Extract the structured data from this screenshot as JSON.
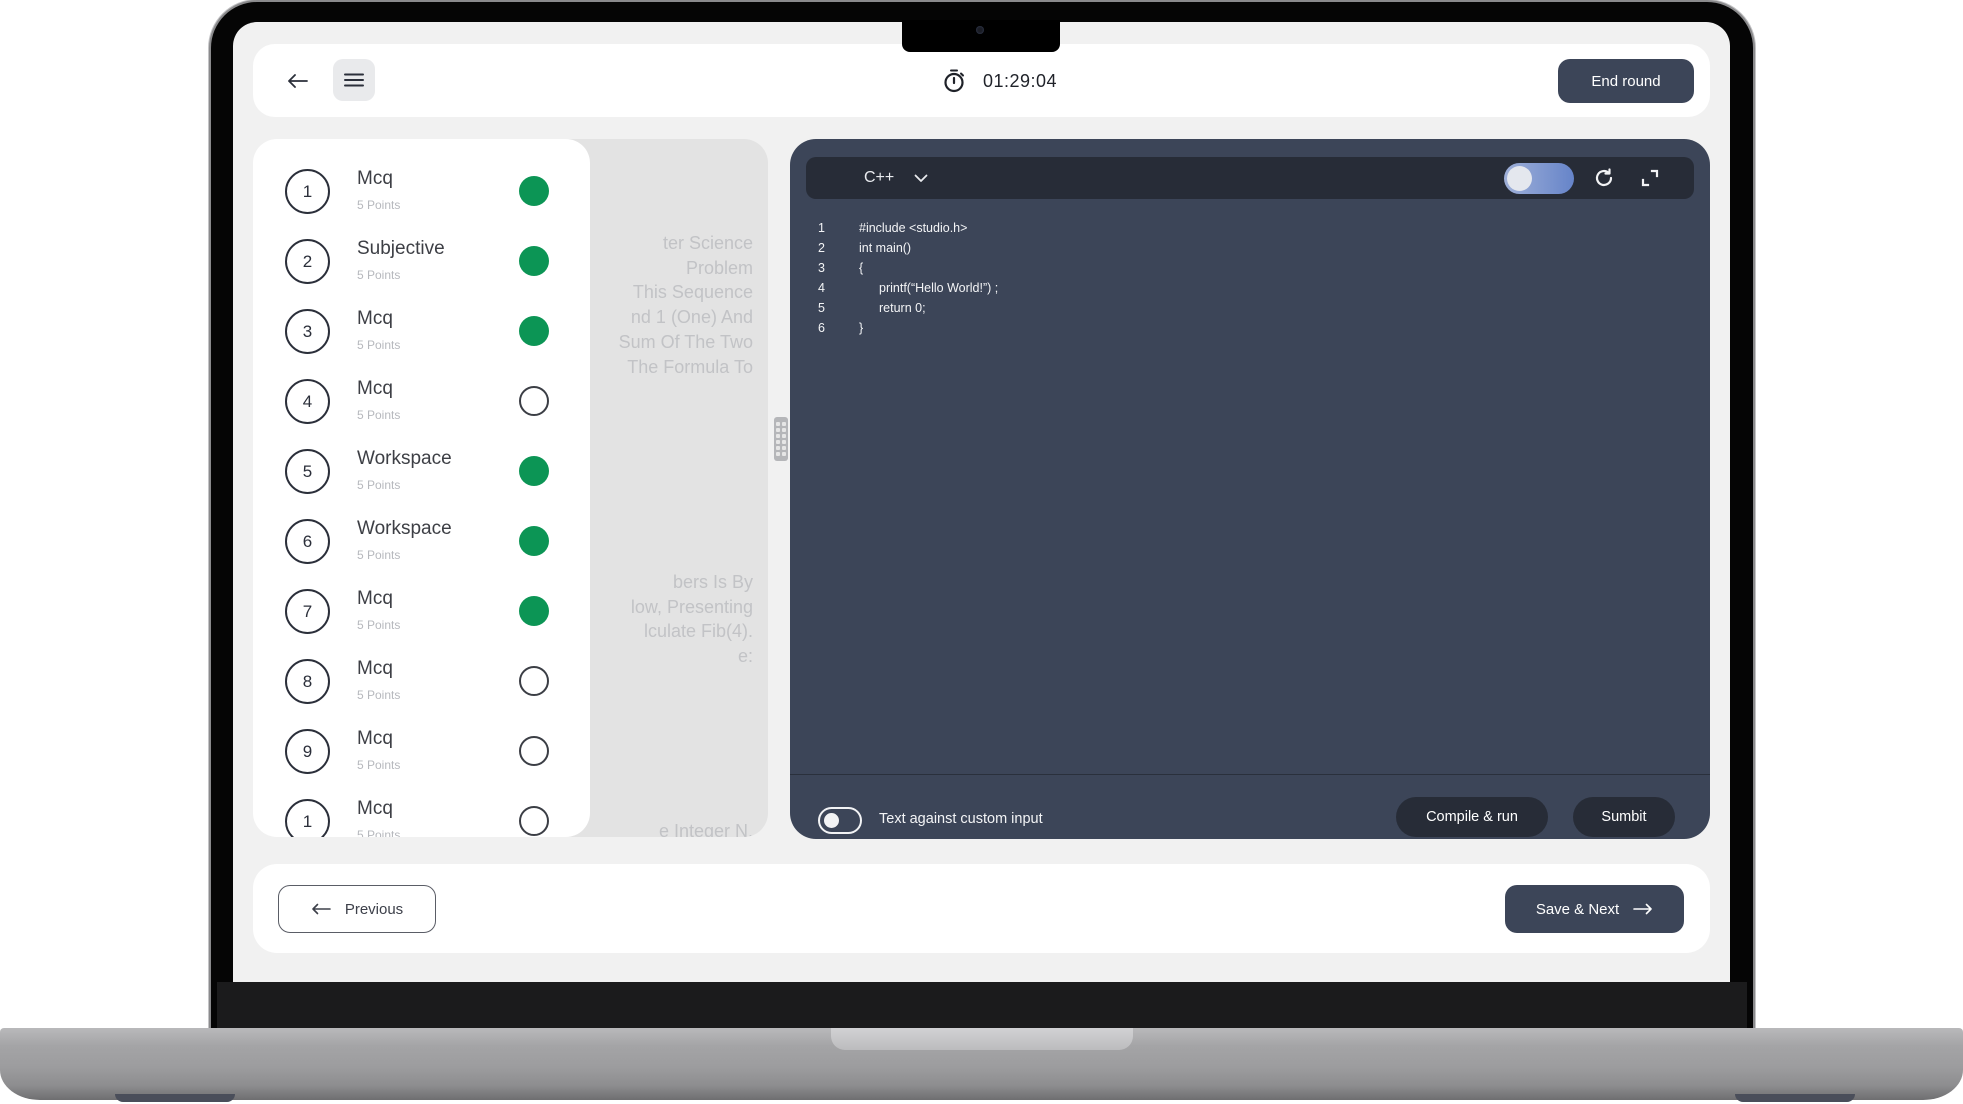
{
  "header": {
    "timer": "01:29:04",
    "end_round_label": "End round"
  },
  "sidebar": {
    "items": [
      {
        "number": "1",
        "title": "Mcq",
        "points": "5 Points",
        "status": "answered"
      },
      {
        "number": "2",
        "title": "Subjective",
        "points": "5 Points",
        "status": "answered"
      },
      {
        "number": "3",
        "title": "Mcq",
        "points": "5 Points",
        "status": "answered"
      },
      {
        "number": "4",
        "title": "Mcq",
        "points": "5 Points",
        "status": "unanswered"
      },
      {
        "number": "5",
        "title": "Workspace",
        "points": "5 Points",
        "status": "answered"
      },
      {
        "number": "6",
        "title": "Workspace",
        "points": "5 Points",
        "status": "answered"
      },
      {
        "number": "7",
        "title": "Mcq",
        "points": "5 Points",
        "status": "answered"
      },
      {
        "number": "8",
        "title": "Mcq",
        "points": "5 Points",
        "status": "unanswered"
      },
      {
        "number": "9",
        "title": "Mcq",
        "points": "5 Points",
        "status": "unanswered"
      },
      {
        "number": "1",
        "title": "Mcq",
        "points": "5 Points",
        "status": "unanswered"
      }
    ]
  },
  "question": {
    "visible_fragments_top": [
      "ter Science",
      "Problem",
      "This Sequence",
      "nd 1 (One) And",
      "Sum Of The Two",
      "The Formula To"
    ],
    "visible_fragments_middle": [
      "bers Is By",
      "low, Presenting",
      "lculate Fib(4).",
      "e:"
    ],
    "visible_fragments_bottom": [
      "e Integer N."
    ]
  },
  "editor": {
    "language": "C++",
    "code_lines": [
      {
        "no": "1",
        "text": "#include <studio.h>",
        "indent": false
      },
      {
        "no": "2",
        "text": "int main()",
        "indent": false
      },
      {
        "no": "3",
        "text": "{",
        "indent": false
      },
      {
        "no": "4",
        "text": "printf(“Hello World!”) ;",
        "indent": true
      },
      {
        "no": "5",
        "text": "return 0;",
        "indent": true
      },
      {
        "no": "6",
        "text": "}",
        "indent": false
      }
    ],
    "custom_input_label": "Text against custom input",
    "custom_input_enabled": false,
    "compile_label": "Compile & run",
    "submit_label": "Sumbit"
  },
  "footer": {
    "previous_label": "Previous",
    "next_label": "Save & Next"
  },
  "colors": {
    "accent": "#3c4558",
    "answered": "#0c9555",
    "editor_bg": "#3c4558",
    "toolbar_bg": "#272c37"
  }
}
